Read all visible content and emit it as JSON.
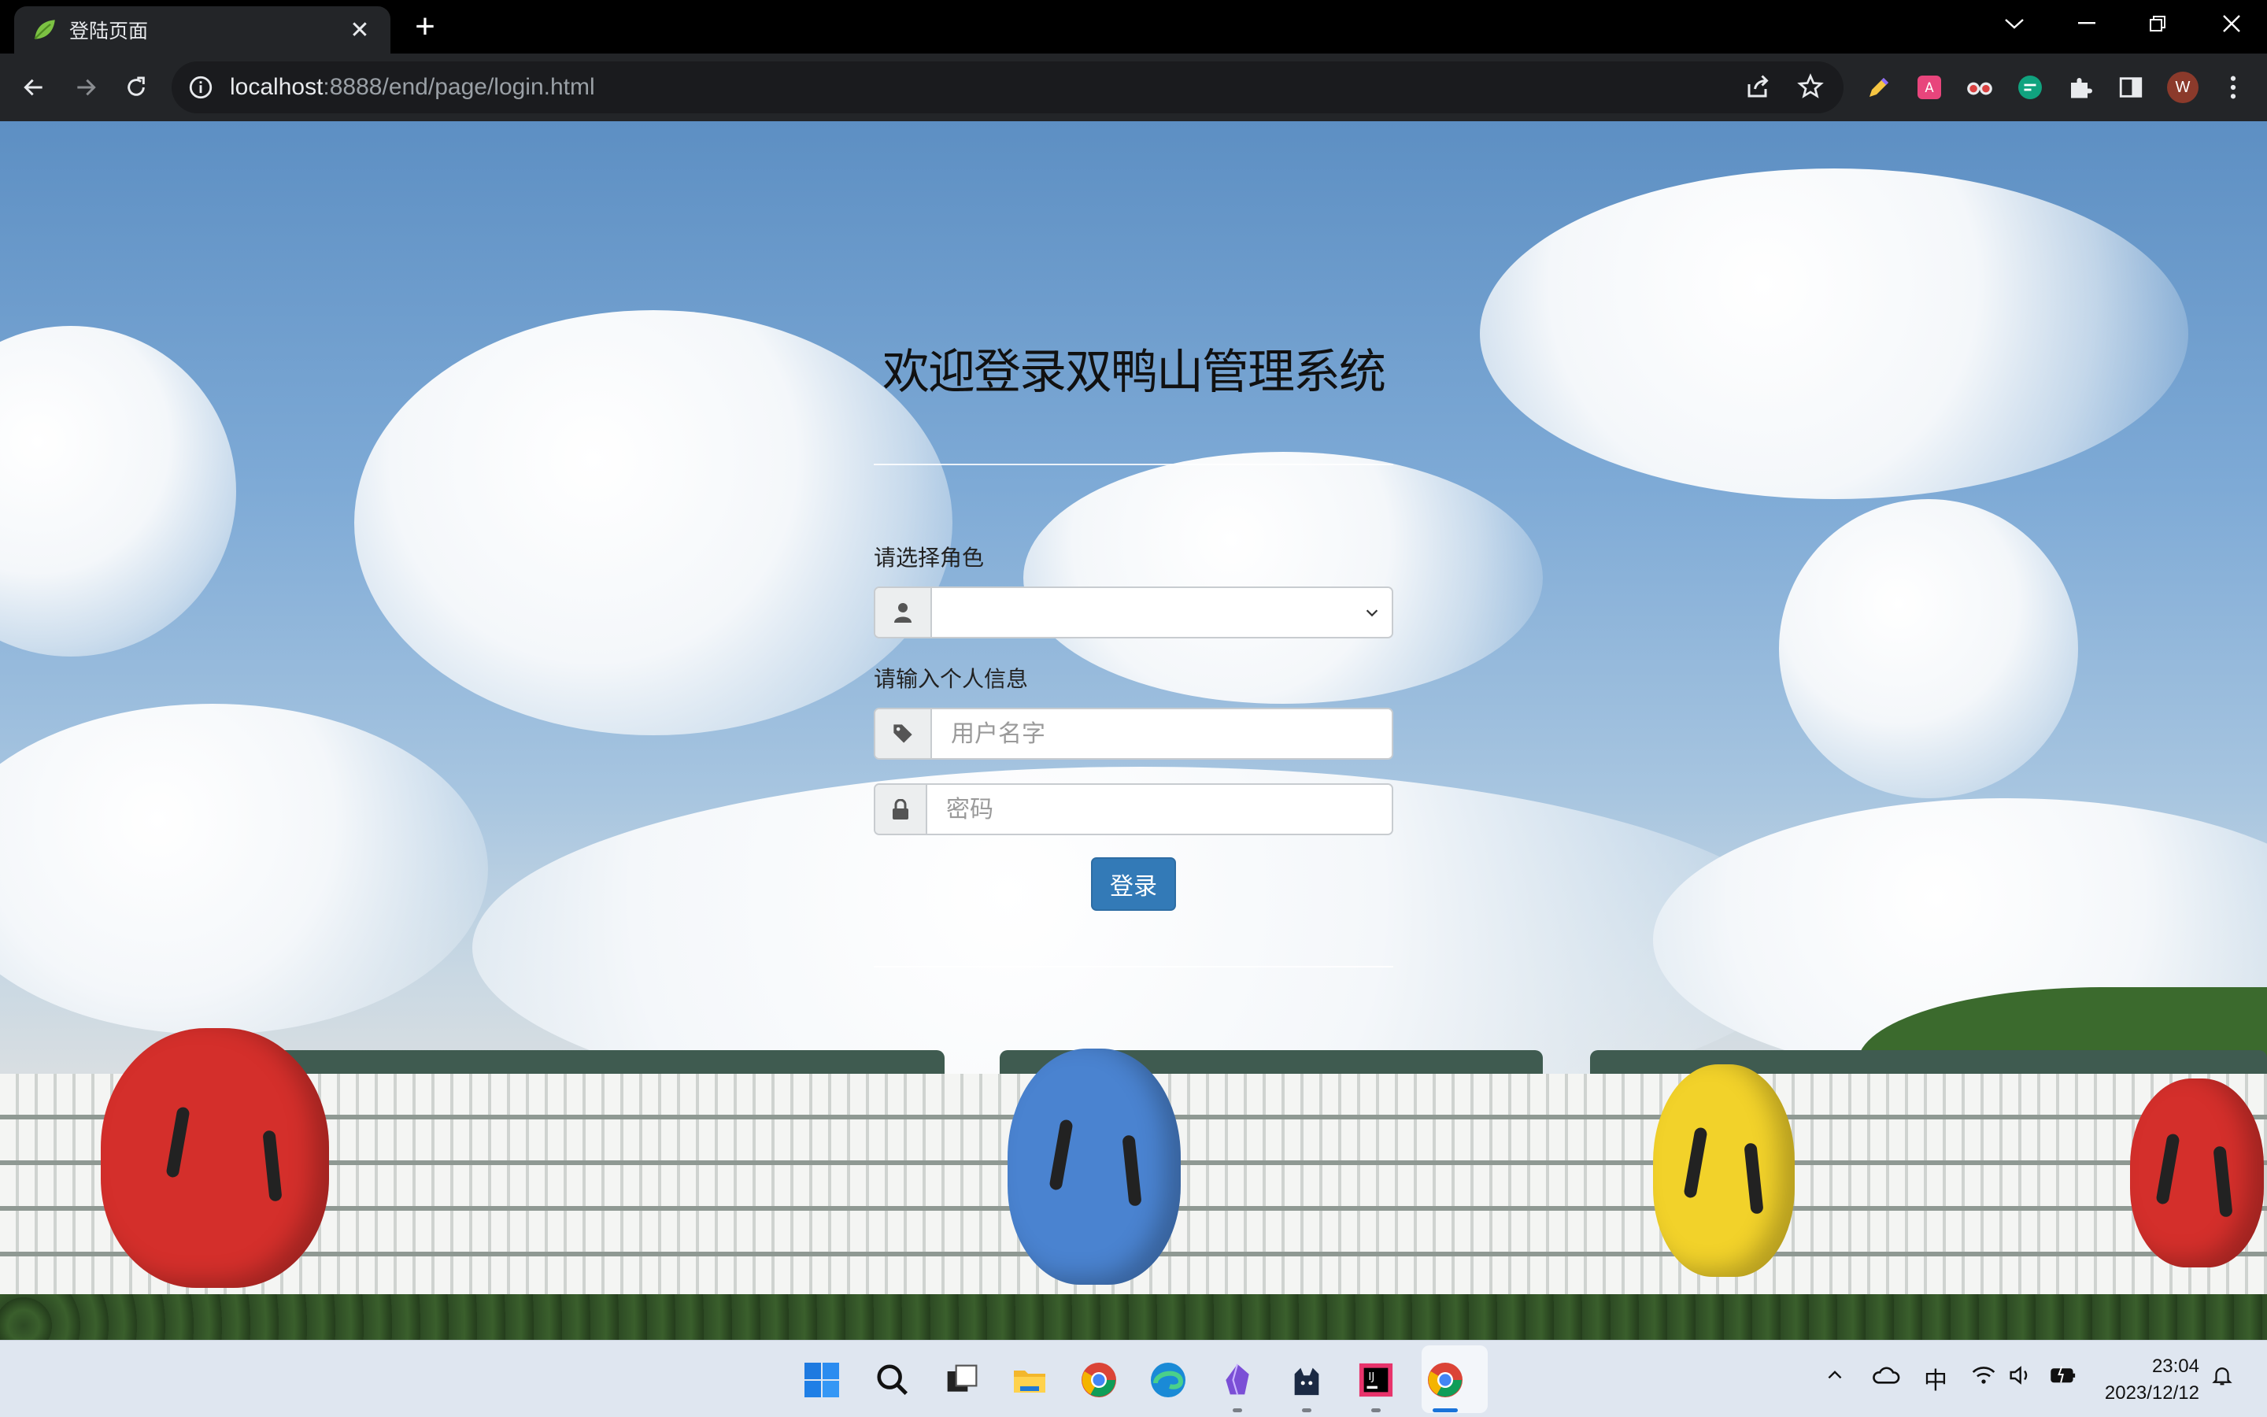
{
  "browser": {
    "tab_title": "登陆页面",
    "tab_close": "✕",
    "new_tab": "+",
    "url_host": "localhost",
    "url_rest": ":8888/end/page/login.html",
    "profile_initial": "W"
  },
  "login": {
    "title": "欢迎登录双鸭山管理系统",
    "role_label": "请选择角色",
    "role_selected": "",
    "info_label": "请输入个人信息",
    "username_placeholder": "用户名字",
    "password_placeholder": "密码",
    "submit_label": "登录"
  },
  "taskbar": {
    "ime": "中",
    "time": "23:04",
    "date": "2023/12/12"
  },
  "colors": {
    "primary_button": "#337ab7",
    "chrome_dark": "#232528"
  },
  "icons": [
    "leaf-favicon",
    "info-icon",
    "back-icon",
    "forward-icon",
    "reload-icon",
    "share-icon",
    "star-icon",
    "user-icon",
    "tag-icon",
    "lock-icon",
    "windows-start-icon",
    "search-icon",
    "chrome-icon",
    "edge-icon"
  ]
}
